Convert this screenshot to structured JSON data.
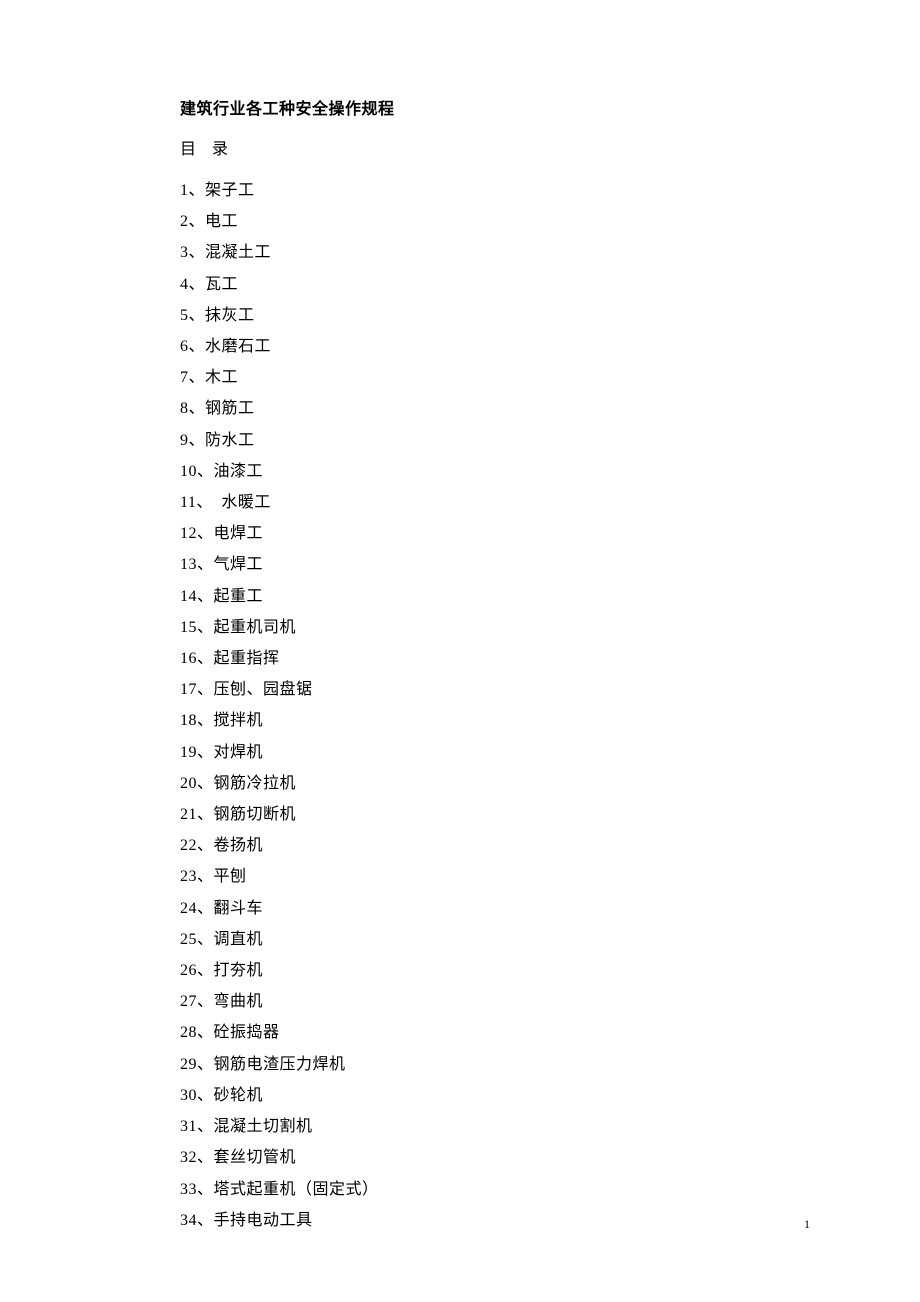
{
  "title": "建筑行业各工种安全操作规程",
  "toc_label": "目　录",
  "toc_items": [
    "1、架子工",
    "2、电工",
    "3、混凝土工",
    "4、瓦工",
    "5、抹灰工",
    "6、水磨石工",
    "7、木工",
    "8、钢筋工",
    "9、防水工",
    "10、油漆工",
    "11、　水暖工",
    "12、电焊工",
    "13、气焊工",
    "14、起重工",
    "15、起重机司机",
    "16、起重指挥",
    "17、压刨、园盘锯",
    "18、搅拌机",
    "19、对焊机",
    "20、钢筋冷拉机",
    "21、钢筋切断机",
    "22、卷扬机",
    "23、平刨",
    "24、翻斗车",
    "25、调直机",
    "26、打夯机",
    "27、弯曲机",
    "28、砼振捣器",
    "29、钢筋电渣压力焊机",
    "30、砂轮机",
    "31、混凝土切割机",
    "32、套丝切管机",
    "33、塔式起重机（固定式）",
    "34、手持电动工具"
  ],
  "page_number": "1"
}
